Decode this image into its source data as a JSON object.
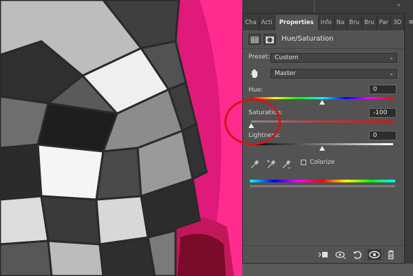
{
  "panel": {
    "tabs": [
      "Cha",
      "Acti",
      "Properties",
      "Info",
      "Na",
      "Bru",
      "Bru",
      "Par",
      "3D"
    ],
    "active_tab": "Properties",
    "menu_glyph": "≡",
    "collapse_glyph": "»",
    "title": "Hue/Saturation",
    "preset": {
      "label": "Preset:",
      "value": "Custom"
    },
    "channel": {
      "value": "Master"
    },
    "hue": {
      "label": "Hue:",
      "value": "0",
      "level": 0.5
    },
    "saturation": {
      "label": "Saturation:",
      "value": "-100",
      "level": 0.0
    },
    "lightness": {
      "label": "Lightness:",
      "value": "0",
      "level": 0.5
    },
    "colorize": {
      "label": "Colorize",
      "checked": false
    },
    "icons": [
      "eyedropper-icon",
      "eyedropper-plus-icon",
      "eyedropper-minus-icon"
    ],
    "bottom_icons": [
      "clip-to-layer-icon",
      "view-previous-state-icon",
      "reset-icon",
      "visibility-icon",
      "delete-icon"
    ]
  },
  "annotation": {
    "circle_color": "#d41515"
  }
}
